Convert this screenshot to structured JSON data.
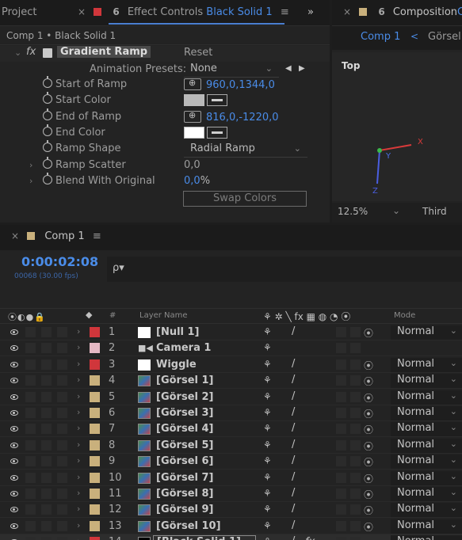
{
  "effect_panel": {
    "tab_project": "Project",
    "tab_effect_prefix": "Effect Controls ",
    "tab_effect_layer": "Black Solid 1",
    "tab_menu": "≡",
    "tab_overflow": "»",
    "breadcrumb": "Comp 1 • Black Solid 1",
    "effect_fx": "fx",
    "effect_name": "Gradient Ramp",
    "reset": "Reset",
    "presets_label": "Animation Presets:",
    "presets_value": "None",
    "start_of_ramp_label": "Start of Ramp",
    "start_of_ramp_value": "960,0,1344,0",
    "start_color_label": "Start Color",
    "start_color_hex": "#b9b9b9",
    "end_of_ramp_label": "End of Ramp",
    "end_of_ramp_value": "816,0,-1220,0",
    "end_color_label": "End Color",
    "end_color_hex": "#ffffff",
    "ramp_shape_label": "Ramp Shape",
    "ramp_shape_value": "Radial Ramp",
    "ramp_scatter_label": "Ramp Scatter",
    "ramp_scatter_value": "0,0",
    "blend_label": "Blend With Original",
    "blend_value": "0,0",
    "blend_unit": "%",
    "swap_colors": "Swap Colors"
  },
  "composition_panel": {
    "tab_label": "Composition",
    "tab_suffix": "C",
    "comp_tab": "Comp 1",
    "nav_prev": "<",
    "other_tab": "Görsel",
    "view_label": "Top",
    "axis_x": "X",
    "axis_y": "Y",
    "axis_z": "Z",
    "zoom": "12.5%",
    "resolution": "Third"
  },
  "timeline": {
    "tab_label": "Comp 1",
    "tab_menu": "≡",
    "timecode": "0:00:02:08",
    "frames": "00068 (30.00 fps)",
    "search_icon_glyph": "ρ▾",
    "col_label_num": "#",
    "col_layer_name": "Layer Name",
    "col_switch_icons": "⚘ ✲ ╲ fx ▦ ◍ ◔ ⦿",
    "col_mode": "Mode",
    "layers": [
      {
        "num": "1",
        "name": "[Null 1]",
        "color": "#d0363b",
        "thumb": "white",
        "slash": true,
        "cube": true,
        "mode": "Normal"
      },
      {
        "num": "2",
        "name": "Camera 1",
        "color": "#e6b8c4",
        "thumb": "camera",
        "slash": false,
        "cube": false,
        "mode": ""
      },
      {
        "num": "3",
        "name": "Wiggle",
        "color": "#d0363b",
        "thumb": "white",
        "slash": true,
        "cube": true,
        "mode": "Normal"
      },
      {
        "num": "4",
        "name": "[Görsel 1]",
        "color": "#c9b07c",
        "thumb": "img",
        "slash": true,
        "cube": true,
        "mode": "Normal"
      },
      {
        "num": "5",
        "name": "[Görsel 2]",
        "color": "#c9b07c",
        "thumb": "img",
        "slash": true,
        "cube": true,
        "mode": "Normal"
      },
      {
        "num": "6",
        "name": "[Görsel 3]",
        "color": "#c9b07c",
        "thumb": "img",
        "slash": true,
        "cube": true,
        "mode": "Normal"
      },
      {
        "num": "7",
        "name": "[Görsel 4]",
        "color": "#c9b07c",
        "thumb": "img",
        "slash": true,
        "cube": true,
        "mode": "Normal"
      },
      {
        "num": "8",
        "name": "[Görsel 5]",
        "color": "#c9b07c",
        "thumb": "img",
        "slash": true,
        "cube": true,
        "mode": "Normal"
      },
      {
        "num": "9",
        "name": "[Görsel 6]",
        "color": "#c9b07c",
        "thumb": "img",
        "slash": true,
        "cube": true,
        "mode": "Normal"
      },
      {
        "num": "10",
        "name": "[Görsel 7]",
        "color": "#c9b07c",
        "thumb": "img",
        "slash": true,
        "cube": true,
        "mode": "Normal"
      },
      {
        "num": "11",
        "name": "[Görsel 8]",
        "color": "#c9b07c",
        "thumb": "img",
        "slash": true,
        "cube": true,
        "mode": "Normal"
      },
      {
        "num": "12",
        "name": "[Görsel 9]",
        "color": "#c9b07c",
        "thumb": "img",
        "slash": true,
        "cube": true,
        "mode": "Normal"
      },
      {
        "num": "13",
        "name": "[Görsel 10]",
        "color": "#c9b07c",
        "thumb": "img",
        "slash": true,
        "cube": true,
        "mode": "Normal"
      },
      {
        "num": "14",
        "name": "[Black Solid 1]",
        "color": "#d0363b",
        "thumb": "black",
        "slash": true,
        "cube": false,
        "fx": "fx",
        "mode": "Normal",
        "selected": true
      }
    ]
  }
}
